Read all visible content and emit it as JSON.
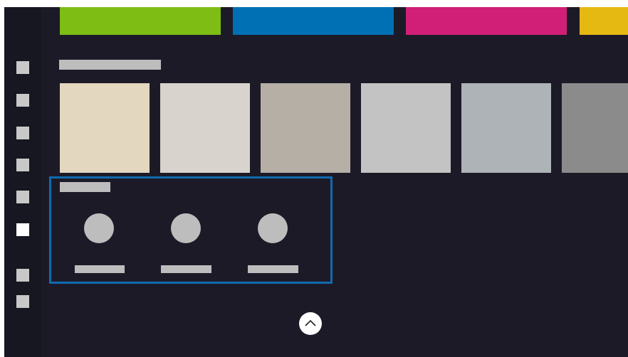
{
  "sidebar": {
    "items": [
      {
        "name": "nav-item-1",
        "active": false
      },
      {
        "name": "nav-item-2",
        "active": false
      },
      {
        "name": "nav-item-3",
        "active": false
      },
      {
        "name": "nav-item-4",
        "active": false
      },
      {
        "name": "nav-item-5",
        "active": false
      },
      {
        "name": "nav-item-6",
        "active": true
      },
      {
        "name": "nav-item-7",
        "active": false
      },
      {
        "name": "nav-item-8",
        "active": false
      }
    ]
  },
  "top_swatches": [
    {
      "color": "#7dbd14"
    },
    {
      "color": "#0070b5"
    },
    {
      "color": "#d11f77"
    },
    {
      "color": "#e6b812"
    }
  ],
  "tiles": [
    {
      "color": "#e3d7c0"
    },
    {
      "color": "#d8d4cd"
    },
    {
      "color": "#b5afa6"
    },
    {
      "color": "#c3c3c3"
    },
    {
      "color": "#aeb3b7"
    },
    {
      "color": "#8b8b8b"
    }
  ],
  "accent": "#0f6bb0",
  "scroll_up_icon": "chevron-up-icon"
}
